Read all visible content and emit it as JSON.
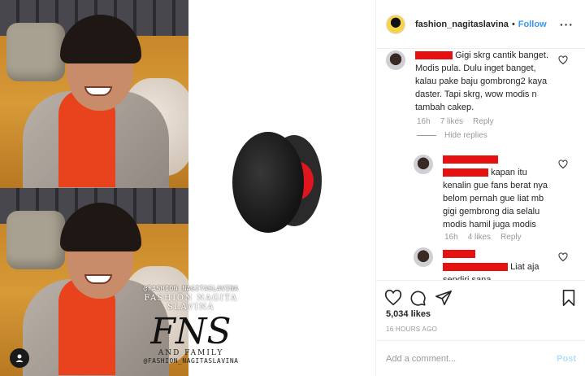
{
  "header": {
    "username": "fashion_nagitaslavina",
    "separator": "•",
    "follow_label": "Follow",
    "more_label": "···"
  },
  "comments": [
    {
      "text": "Gigi skrg cantik banget. Modis pula. Dulu inget banget, kalau pake baju gombrong2 kaya daster. Tapi skrg, wow modis n tambah cakep.",
      "time": "16h",
      "likes": "7 likes",
      "reply_label": "Reply",
      "hide_replies_label": "Hide replies"
    },
    {
      "text": "kapan itu kenalin gue fans berat nya belom pernah gue liat mb gigi gembrong dia selalu modis hamil juga modis",
      "time": "16h",
      "likes": "4 likes",
      "reply_label": "Reply"
    },
    {
      "text": "Liat aja sendiri sana"
    }
  ],
  "post": {
    "likes": "5,034 likes",
    "timestamp": "16 HOURS AGO"
  },
  "composer": {
    "placeholder": "Add a comment...",
    "post_label": "Post"
  },
  "watermark": {
    "handle": "@FASHION_NAGITASLAVINA",
    "name": "FASHION NAGITA SLAVINA",
    "logo": "FNS",
    "family": "AND FAMILY",
    "handle_bottom": "@FASHION_NAGITASLAVINA"
  },
  "colors": {
    "link": "#3897f0",
    "redaction": "#e51111",
    "post_disabled": "#b2dffc"
  }
}
